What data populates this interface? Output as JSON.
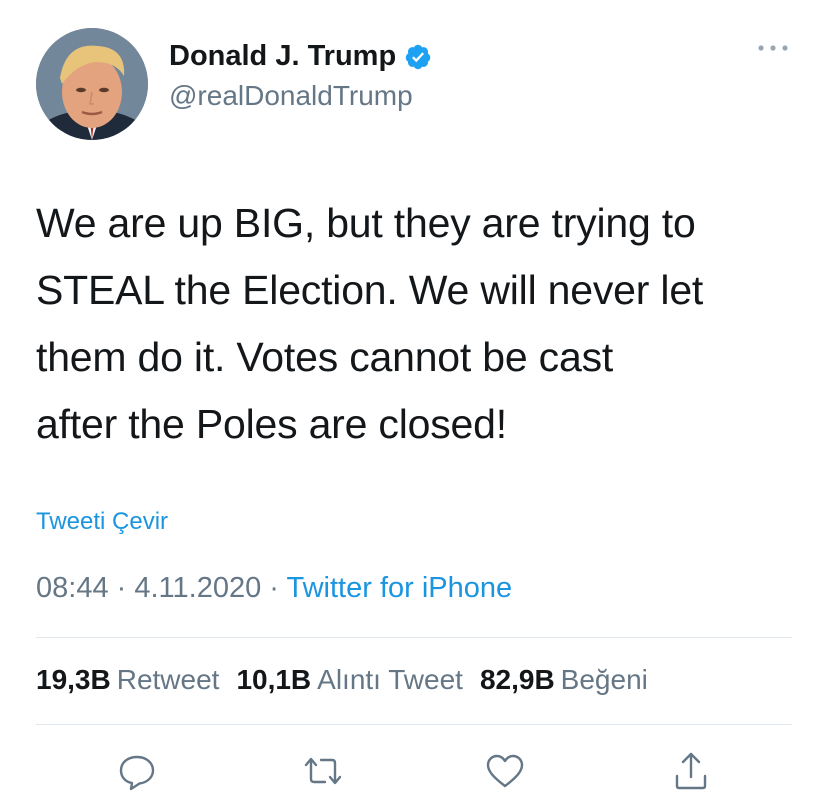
{
  "author": {
    "display_name": "Donald J. Trump",
    "handle": "@realDonaldTrump",
    "verified": true
  },
  "tweet": {
    "text_lines": [
      "We are up BIG, but they are trying to",
      "STEAL the Election. We will never let",
      "them do it. Votes cannot be cast",
      "after the Poles are closed!"
    ],
    "translate_label": "Tweeti Çevir",
    "time": "08:44",
    "date": "4.11.2020",
    "separator": "·",
    "source": "Twitter for iPhone"
  },
  "stats": {
    "retweets": {
      "count": "19,3B",
      "label": "Retweet"
    },
    "quotes": {
      "count": "10,1B",
      "label": "Alıntı Tweet"
    },
    "likes": {
      "count": "82,9B",
      "label": "Beğeni"
    }
  },
  "actions": [
    "reply-icon",
    "retweet-icon",
    "like-icon",
    "share-icon"
  ],
  "colors": {
    "text": "#14171a",
    "secondary": "#657786",
    "link": "#1b95e0",
    "verified": "#1da1f2",
    "divider": "#e1e8ed"
  }
}
